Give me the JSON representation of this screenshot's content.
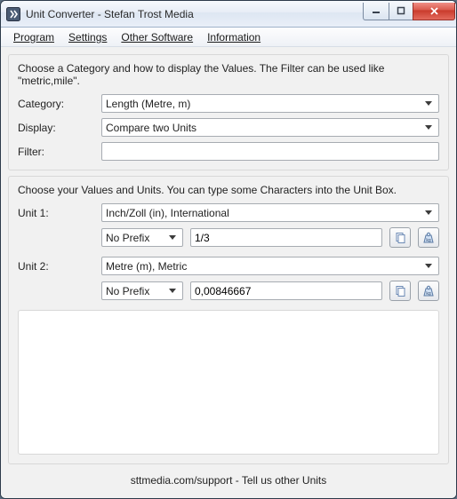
{
  "window": {
    "title": "Unit Converter - Stefan Trost Media"
  },
  "menu": {
    "program": "Program",
    "settings": "Settings",
    "other_software": "Other Software",
    "information": "Information"
  },
  "top": {
    "hint": "Choose a Category and how to display the Values. The Filter can be used like \"metric,mile\".",
    "category_label": "Category:",
    "category_value": "Length (Metre, m)",
    "display_label": "Display:",
    "display_value": "Compare two Units",
    "filter_label": "Filter:",
    "filter_value": ""
  },
  "units": {
    "hint": "Choose your Values and Units. You can type some Characters into the Unit Box.",
    "unit1_label": "Unit 1:",
    "unit1_unit": "Inch/Zoll (in), International",
    "unit1_prefix": "No Prefix",
    "unit1_value": "1/3",
    "unit2_label": "Unit 2:",
    "unit2_unit": "Metre (m), Metric",
    "unit2_prefix": "No Prefix",
    "unit2_value": "0,00846667"
  },
  "footer": {
    "text": "sttmedia.com/support - Tell us other Units"
  },
  "icons": {
    "copy": "copy-icon",
    "swap": "swap-unit-icon"
  }
}
